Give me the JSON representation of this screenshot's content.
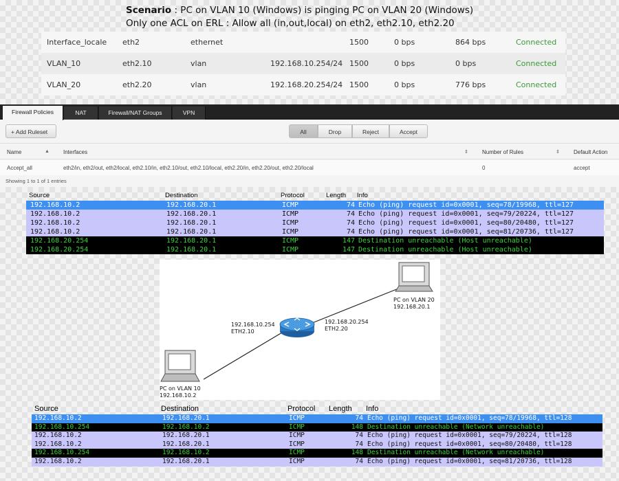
{
  "scenario": {
    "label": "Scenario",
    "line1_rest": " : PC on VLAN 10 (Windows)  is pinging PC on VLAN 20 (Windows)",
    "line2": "Only one ACL on ERL : Allow all (in,out,local) on eth2, eth2.10, eth2.20"
  },
  "interfaces": [
    {
      "name": "Interface_locale",
      "dev": "eth2",
      "type": "ethernet",
      "ip": "",
      "mtu": "1500",
      "tx": "0 bps",
      "rx": "864 bps",
      "status": "Connected"
    },
    {
      "name": "VLAN_10",
      "dev": "eth2.10",
      "type": "vlan",
      "ip": "192.168.10.254/24",
      "mtu": "1500",
      "tx": "0 bps",
      "rx": "0 bps",
      "status": "Connected"
    },
    {
      "name": "VLAN_20",
      "dev": "eth2.20",
      "type": "vlan",
      "ip": "192.168.20.254/24",
      "mtu": "1500",
      "tx": "0 bps",
      "rx": "776 bps",
      "status": "Connected"
    }
  ],
  "firewall": {
    "tabs": [
      "Firewall Policies",
      "NAT",
      "Firewall/NAT Groups",
      "VPN"
    ],
    "add_ruleset": "+ Add Ruleset",
    "filters": [
      "All",
      "Drop",
      "Reject",
      "Accept"
    ],
    "columns": {
      "name": "Name",
      "interfaces": "Interfaces",
      "rules": "Number of Rules",
      "action": "Default Action"
    },
    "row": {
      "name": "Accept_all",
      "interfaces": "eth2/in, eth2/out, eth2/local, eth2.10/in, eth2.10/out, eth2.10/local, eth2.20/in, eth2.20/out, eth2.20/local",
      "rules": "0",
      "action": "accept"
    },
    "footer": "Showing 1 to 1 of 1 entries"
  },
  "capture1": {
    "headers": {
      "source": "Source",
      "destination": "Destination",
      "protocol": "Protocol",
      "length": "Length",
      "info": "Info"
    },
    "rows": [
      {
        "style": "sel",
        "src": "192.168.10.2",
        "dst": "192.168.20.1",
        "proto": "ICMP",
        "len": "74",
        "info": "Echo (ping) request  id=0x0001, seq=78/19968, ttl=127"
      },
      {
        "style": "echo",
        "src": "192.168.10.2",
        "dst": "192.168.20.1",
        "proto": "ICMP",
        "len": "74",
        "info": "Echo (ping) request  id=0x0001, seq=79/20224, ttl=127"
      },
      {
        "style": "echo",
        "src": "192.168.10.2",
        "dst": "192.168.20.1",
        "proto": "ICMP",
        "len": "74",
        "info": "Echo (ping) request  id=0x0001, seq=80/20480, ttl=127"
      },
      {
        "style": "echo",
        "src": "192.168.10.2",
        "dst": "192.168.20.1",
        "proto": "ICMP",
        "len": "74",
        "info": "Echo (ping) request  id=0x0001, seq=81/20736, ttl=127"
      },
      {
        "style": "unreach",
        "src": "192.168.20.254",
        "dst": "192.168.20.1",
        "proto": "ICMP",
        "len": "147",
        "info": "Destination unreachable (Host unreachable)"
      },
      {
        "style": "unreach",
        "src": "192.168.20.254",
        "dst": "192.168.20.1",
        "proto": "ICMP",
        "len": "147",
        "info": "Destination unreachable (Host unreachable)"
      }
    ]
  },
  "diagram": {
    "pc20_name": "PC on VLAN 20",
    "pc20_ip": "192.168.20.1",
    "router_left_ip": "192.168.10.254",
    "router_left_if": "ETH2.10",
    "router_right_ip": "192.168.20.254",
    "router_right_if": "ETH2.20",
    "pc10_name": "PC on VLAN 10",
    "pc10_ip": "192.168.10.2"
  },
  "capture2": {
    "headers": {
      "source": "Source",
      "destination": "Destination",
      "protocol": "Protocol",
      "length": "Length",
      "info": "Info"
    },
    "rows": [
      {
        "style": "sel",
        "src": "192.168.10.2",
        "dst": "192.168.20.1",
        "proto": "ICMP",
        "len": "74",
        "info": "Echo (ping) request  id=0x0001, seq=78/19968, ttl=128"
      },
      {
        "style": "unreach",
        "src": "192.168.10.254",
        "dst": "192.168.10.2",
        "proto": "ICMP",
        "len": "148",
        "info": "Destination unreachable (Network unreachable)"
      },
      {
        "style": "echo",
        "src": "192.168.10.2",
        "dst": "192.168.20.1",
        "proto": "ICMP",
        "len": "74",
        "info": "Echo (ping) request  id=0x0001, seq=79/20224, ttl=128"
      },
      {
        "style": "echo",
        "src": "192.168.10.2",
        "dst": "192.168.20.1",
        "proto": "ICMP",
        "len": "74",
        "info": "Echo (ping) request  id=0x0001, seq=80/20480, ttl=128"
      },
      {
        "style": "unreach",
        "src": "192.168.10.254",
        "dst": "192.168.10.2",
        "proto": "ICMP",
        "len": "148",
        "info": "Destination unreachable (Network unreachable)"
      },
      {
        "style": "echo",
        "src": "192.168.10.2",
        "dst": "192.168.20.1",
        "proto": "ICMP",
        "len": "74",
        "info": "Echo (ping) request  id=0x0001, seq=81/20736, ttl=128"
      }
    ]
  },
  "colors": {
    "selected_row": "#3e8ff2",
    "echo_row": "#c8c6fb",
    "unreachable_row": "#000000",
    "unreachable_text": "#39d239",
    "connected": "#3a9a3a"
  }
}
